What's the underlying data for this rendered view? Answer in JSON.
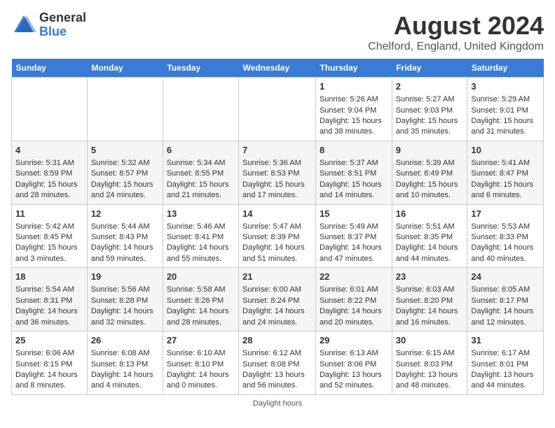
{
  "header": {
    "logo_general": "General",
    "logo_blue": "Blue",
    "title": "August 2024",
    "subtitle": "Chelford, England, United Kingdom"
  },
  "days_of_week": [
    "Sunday",
    "Monday",
    "Tuesday",
    "Wednesday",
    "Thursday",
    "Friday",
    "Saturday"
  ],
  "weeks": [
    [
      {
        "day": "",
        "sunrise": "",
        "sunset": "",
        "daylight": ""
      },
      {
        "day": "",
        "sunrise": "",
        "sunset": "",
        "daylight": ""
      },
      {
        "day": "",
        "sunrise": "",
        "sunset": "",
        "daylight": ""
      },
      {
        "day": "",
        "sunrise": "",
        "sunset": "",
        "daylight": ""
      },
      {
        "day": "1",
        "sunrise": "Sunrise: 5:26 AM",
        "sunset": "Sunset: 9:04 PM",
        "daylight": "Daylight: 15 hours and 38 minutes."
      },
      {
        "day": "2",
        "sunrise": "Sunrise: 5:27 AM",
        "sunset": "Sunset: 9:03 PM",
        "daylight": "Daylight: 15 hours and 35 minutes."
      },
      {
        "day": "3",
        "sunrise": "Sunrise: 5:29 AM",
        "sunset": "Sunset: 9:01 PM",
        "daylight": "Daylight: 15 hours and 31 minutes."
      }
    ],
    [
      {
        "day": "4",
        "sunrise": "Sunrise: 5:31 AM",
        "sunset": "Sunset: 8:59 PM",
        "daylight": "Daylight: 15 hours and 28 minutes."
      },
      {
        "day": "5",
        "sunrise": "Sunrise: 5:32 AM",
        "sunset": "Sunset: 8:57 PM",
        "daylight": "Daylight: 15 hours and 24 minutes."
      },
      {
        "day": "6",
        "sunrise": "Sunrise: 5:34 AM",
        "sunset": "Sunset: 8:55 PM",
        "daylight": "Daylight: 15 hours and 21 minutes."
      },
      {
        "day": "7",
        "sunrise": "Sunrise: 5:36 AM",
        "sunset": "Sunset: 8:53 PM",
        "daylight": "Daylight: 15 hours and 17 minutes."
      },
      {
        "day": "8",
        "sunrise": "Sunrise: 5:37 AM",
        "sunset": "Sunset: 8:51 PM",
        "daylight": "Daylight: 15 hours and 14 minutes."
      },
      {
        "day": "9",
        "sunrise": "Sunrise: 5:39 AM",
        "sunset": "Sunset: 8:49 PM",
        "daylight": "Daylight: 15 hours and 10 minutes."
      },
      {
        "day": "10",
        "sunrise": "Sunrise: 5:41 AM",
        "sunset": "Sunset: 8:47 PM",
        "daylight": "Daylight: 15 hours and 6 minutes."
      }
    ],
    [
      {
        "day": "11",
        "sunrise": "Sunrise: 5:42 AM",
        "sunset": "Sunset: 8:45 PM",
        "daylight": "Daylight: 15 hours and 3 minutes."
      },
      {
        "day": "12",
        "sunrise": "Sunrise: 5:44 AM",
        "sunset": "Sunset: 8:43 PM",
        "daylight": "Daylight: 14 hours and 59 minutes."
      },
      {
        "day": "13",
        "sunrise": "Sunrise: 5:46 AM",
        "sunset": "Sunset: 8:41 PM",
        "daylight": "Daylight: 14 hours and 55 minutes."
      },
      {
        "day": "14",
        "sunrise": "Sunrise: 5:47 AM",
        "sunset": "Sunset: 8:39 PM",
        "daylight": "Daylight: 14 hours and 51 minutes."
      },
      {
        "day": "15",
        "sunrise": "Sunrise: 5:49 AM",
        "sunset": "Sunset: 8:37 PM",
        "daylight": "Daylight: 14 hours and 47 minutes."
      },
      {
        "day": "16",
        "sunrise": "Sunrise: 5:51 AM",
        "sunset": "Sunset: 8:35 PM",
        "daylight": "Daylight: 14 hours and 44 minutes."
      },
      {
        "day": "17",
        "sunrise": "Sunrise: 5:53 AM",
        "sunset": "Sunset: 8:33 PM",
        "daylight": "Daylight: 14 hours and 40 minutes."
      }
    ],
    [
      {
        "day": "18",
        "sunrise": "Sunrise: 5:54 AM",
        "sunset": "Sunset: 8:31 PM",
        "daylight": "Daylight: 14 hours and 36 minutes."
      },
      {
        "day": "19",
        "sunrise": "Sunrise: 5:56 AM",
        "sunset": "Sunset: 8:28 PM",
        "daylight": "Daylight: 14 hours and 32 minutes."
      },
      {
        "day": "20",
        "sunrise": "Sunrise: 5:58 AM",
        "sunset": "Sunset: 8:26 PM",
        "daylight": "Daylight: 14 hours and 28 minutes."
      },
      {
        "day": "21",
        "sunrise": "Sunrise: 6:00 AM",
        "sunset": "Sunset: 8:24 PM",
        "daylight": "Daylight: 14 hours and 24 minutes."
      },
      {
        "day": "22",
        "sunrise": "Sunrise: 6:01 AM",
        "sunset": "Sunset: 8:22 PM",
        "daylight": "Daylight: 14 hours and 20 minutes."
      },
      {
        "day": "23",
        "sunrise": "Sunrise: 6:03 AM",
        "sunset": "Sunset: 8:20 PM",
        "daylight": "Daylight: 14 hours and 16 minutes."
      },
      {
        "day": "24",
        "sunrise": "Sunrise: 6:05 AM",
        "sunset": "Sunset: 8:17 PM",
        "daylight": "Daylight: 14 hours and 12 minutes."
      }
    ],
    [
      {
        "day": "25",
        "sunrise": "Sunrise: 6:06 AM",
        "sunset": "Sunset: 8:15 PM",
        "daylight": "Daylight: 14 hours and 8 minutes."
      },
      {
        "day": "26",
        "sunrise": "Sunrise: 6:08 AM",
        "sunset": "Sunset: 8:13 PM",
        "daylight": "Daylight: 14 hours and 4 minutes."
      },
      {
        "day": "27",
        "sunrise": "Sunrise: 6:10 AM",
        "sunset": "Sunset: 8:10 PM",
        "daylight": "Daylight: 14 hours and 0 minutes."
      },
      {
        "day": "28",
        "sunrise": "Sunrise: 6:12 AM",
        "sunset": "Sunset: 8:08 PM",
        "daylight": "Daylight: 13 hours and 56 minutes."
      },
      {
        "day": "29",
        "sunrise": "Sunrise: 6:13 AM",
        "sunset": "Sunset: 8:06 PM",
        "daylight": "Daylight: 13 hours and 52 minutes."
      },
      {
        "day": "30",
        "sunrise": "Sunrise: 6:15 AM",
        "sunset": "Sunset: 8:03 PM",
        "daylight": "Daylight: 13 hours and 48 minutes."
      },
      {
        "day": "31",
        "sunrise": "Sunrise: 6:17 AM",
        "sunset": "Sunset: 8:01 PM",
        "daylight": "Daylight: 13 hours and 44 minutes."
      }
    ]
  ],
  "footer": "Daylight hours"
}
